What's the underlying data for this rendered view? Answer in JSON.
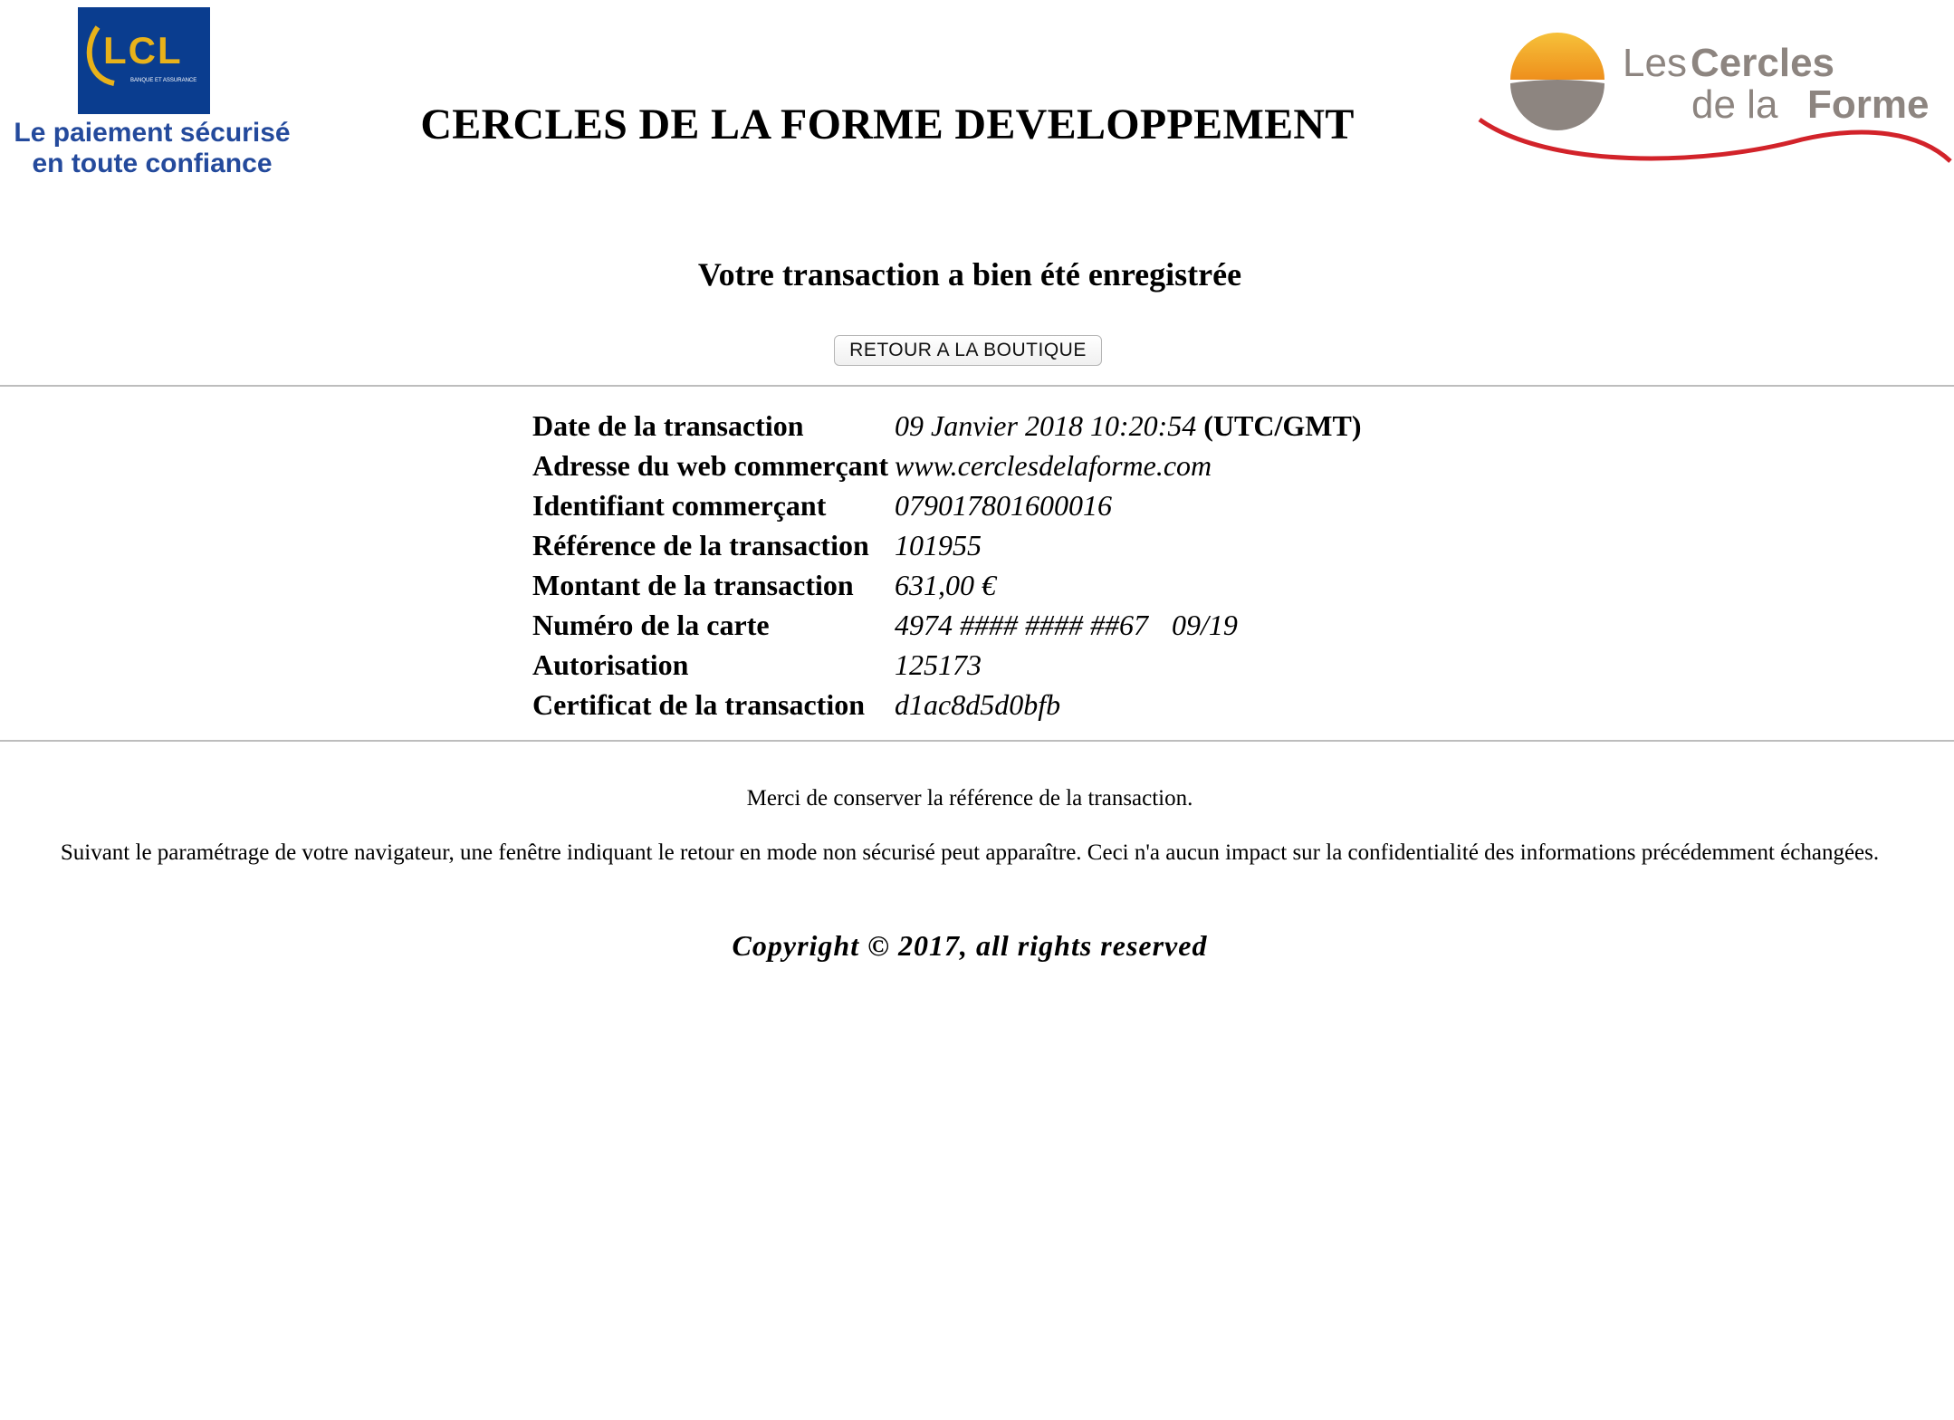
{
  "header": {
    "lcl_logo_text": "LCL",
    "lcl_logo_subtext": "BANQUE ET ASSURANCE",
    "lcl_tagline_line1": "Le paiement sécurisé",
    "lcl_tagline_line2": "en toute confiance",
    "merchant_name": "CERCLES DE LA FORME DEVELOPPEMENT",
    "merchant_logo_line1_light": "Les",
    "merchant_logo_line1_bold": "Cercles",
    "merchant_logo_line2_light": "de la",
    "merchant_logo_line2_bold": "Forme"
  },
  "confirmation": {
    "title": "Votre transaction a bien été enregistrée",
    "return_button_label": "RETOUR A LA BOUTIQUE"
  },
  "transaction": {
    "rows": [
      {
        "label": "Date de la transaction",
        "value": "09 Janvier 2018 10:20:54",
        "suffix": "(UTC/GMT)"
      },
      {
        "label": "Adresse du web commerçant",
        "value": "www.cerclesdelaforme.com"
      },
      {
        "label": "Identifiant commerçant",
        "value": "079017801600016"
      },
      {
        "label": "Référence de la transaction",
        "value": "101955"
      },
      {
        "label": "Montant de la transaction",
        "value": "631,00 €"
      },
      {
        "label": "Numéro de la carte",
        "value": "4974 #### #### ##67",
        "expiry": "09/19"
      },
      {
        "label": "Autorisation",
        "value": "125173"
      },
      {
        "label": "Certificat de la transaction",
        "value": "d1ac8d5d0bfb"
      }
    ]
  },
  "footer": {
    "keep_reference_note": "Merci de conserver la référence de la transaction.",
    "browser_note": "Suivant le paramétrage de votre navigateur, une fenêtre indiquant le retour en mode non sécurisé peut apparaître. Ceci n'a aucun impact sur la confidentialité des informations précédemment échangées.",
    "copyright": "Copyright © 2017, all rights reserved"
  },
  "colors": {
    "lcl_blue": "#0a3d8f",
    "lcl_gold": "#e8b21a",
    "tagline_blue": "#244a9c",
    "cercles_red": "#d2232a",
    "cercles_orange": "#f2a51a",
    "cercles_grey": "#8d8580"
  }
}
